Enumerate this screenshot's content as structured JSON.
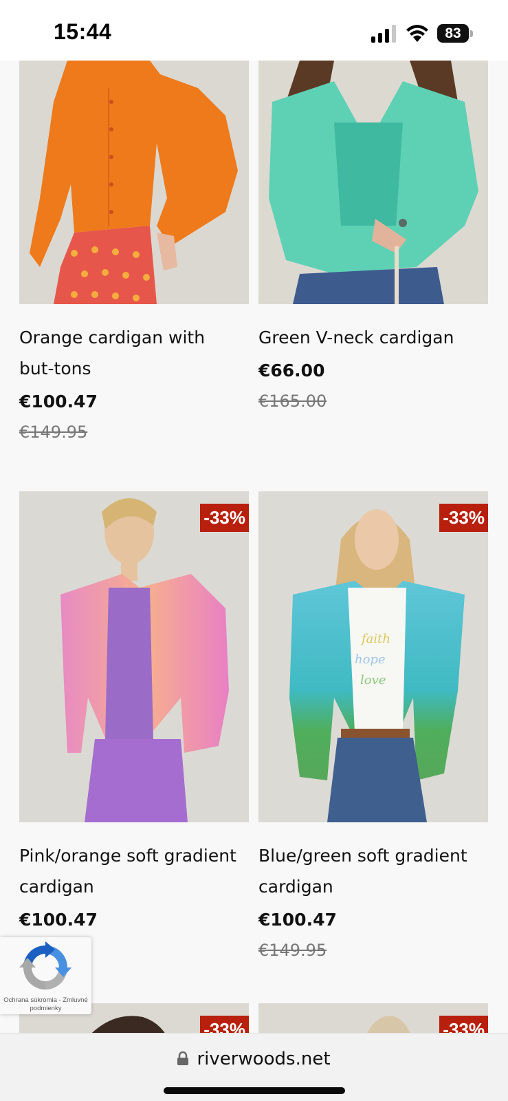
{
  "status_bar": {
    "time": "15:44",
    "battery": "83",
    "icons": [
      "signal-icon",
      "wifi-icon",
      "battery-icon"
    ]
  },
  "products": [
    {
      "title": "Orange cardigan with but-tons",
      "price": "€100.47",
      "old_price": "€149.95",
      "badge": ""
    },
    {
      "title": "Green V-neck cardigan",
      "price": "€66.00",
      "old_price": "€165.00",
      "badge": ""
    },
    {
      "title": "Pink/orange soft gradient cardigan",
      "price": "€100.47",
      "old_price": "",
      "badge": "-33%"
    },
    {
      "title": "Blue/green soft gradient cardigan",
      "price": "€100.47",
      "old_price": "€149.95",
      "badge": "-33%"
    },
    {
      "badge": "-33%"
    },
    {
      "badge": "-33%"
    }
  ],
  "recaptcha": {
    "text": "Ochrana súkromia - Zmluvné podmienky"
  },
  "browser": {
    "url": "riverwoods.net"
  },
  "colors": {
    "badge": "#b8200d",
    "background": "#f8f8f8",
    "old_price": "#777777"
  }
}
